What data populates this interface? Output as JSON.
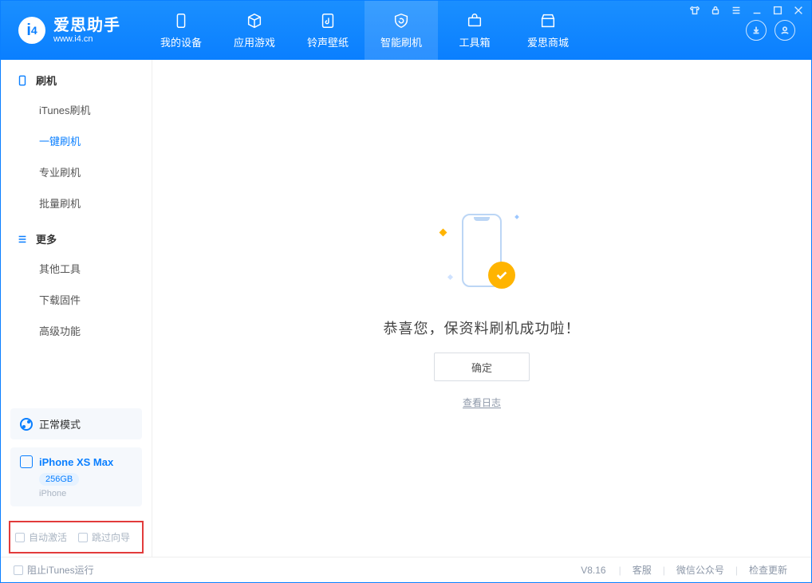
{
  "app": {
    "title": "爱思助手",
    "url": "www.i4.cn"
  },
  "nav": {
    "tabs": [
      {
        "label": "我的设备"
      },
      {
        "label": "应用游戏"
      },
      {
        "label": "铃声壁纸"
      },
      {
        "label": "智能刷机"
      },
      {
        "label": "工具箱"
      },
      {
        "label": "爱思商城"
      }
    ]
  },
  "sidebar": {
    "flash_header": "刷机",
    "flash_items": [
      "iTunes刷机",
      "一键刷机",
      "专业刷机",
      "批量刷机"
    ],
    "more_header": "更多",
    "more_items": [
      "其他工具",
      "下载固件",
      "高级功能"
    ]
  },
  "device": {
    "mode": "正常模式",
    "name": "iPhone XS Max",
    "capacity": "256GB",
    "type": "iPhone"
  },
  "options": {
    "auto_activate": "自动激活",
    "skip_guide": "跳过向导"
  },
  "result": {
    "message": "恭喜您，保资料刷机成功啦！",
    "ok": "确定",
    "view_log": "查看日志"
  },
  "footer": {
    "block_itunes": "阻止iTunes运行",
    "version": "V8.16",
    "support": "客服",
    "wechat": "微信公众号",
    "update": "检查更新"
  }
}
